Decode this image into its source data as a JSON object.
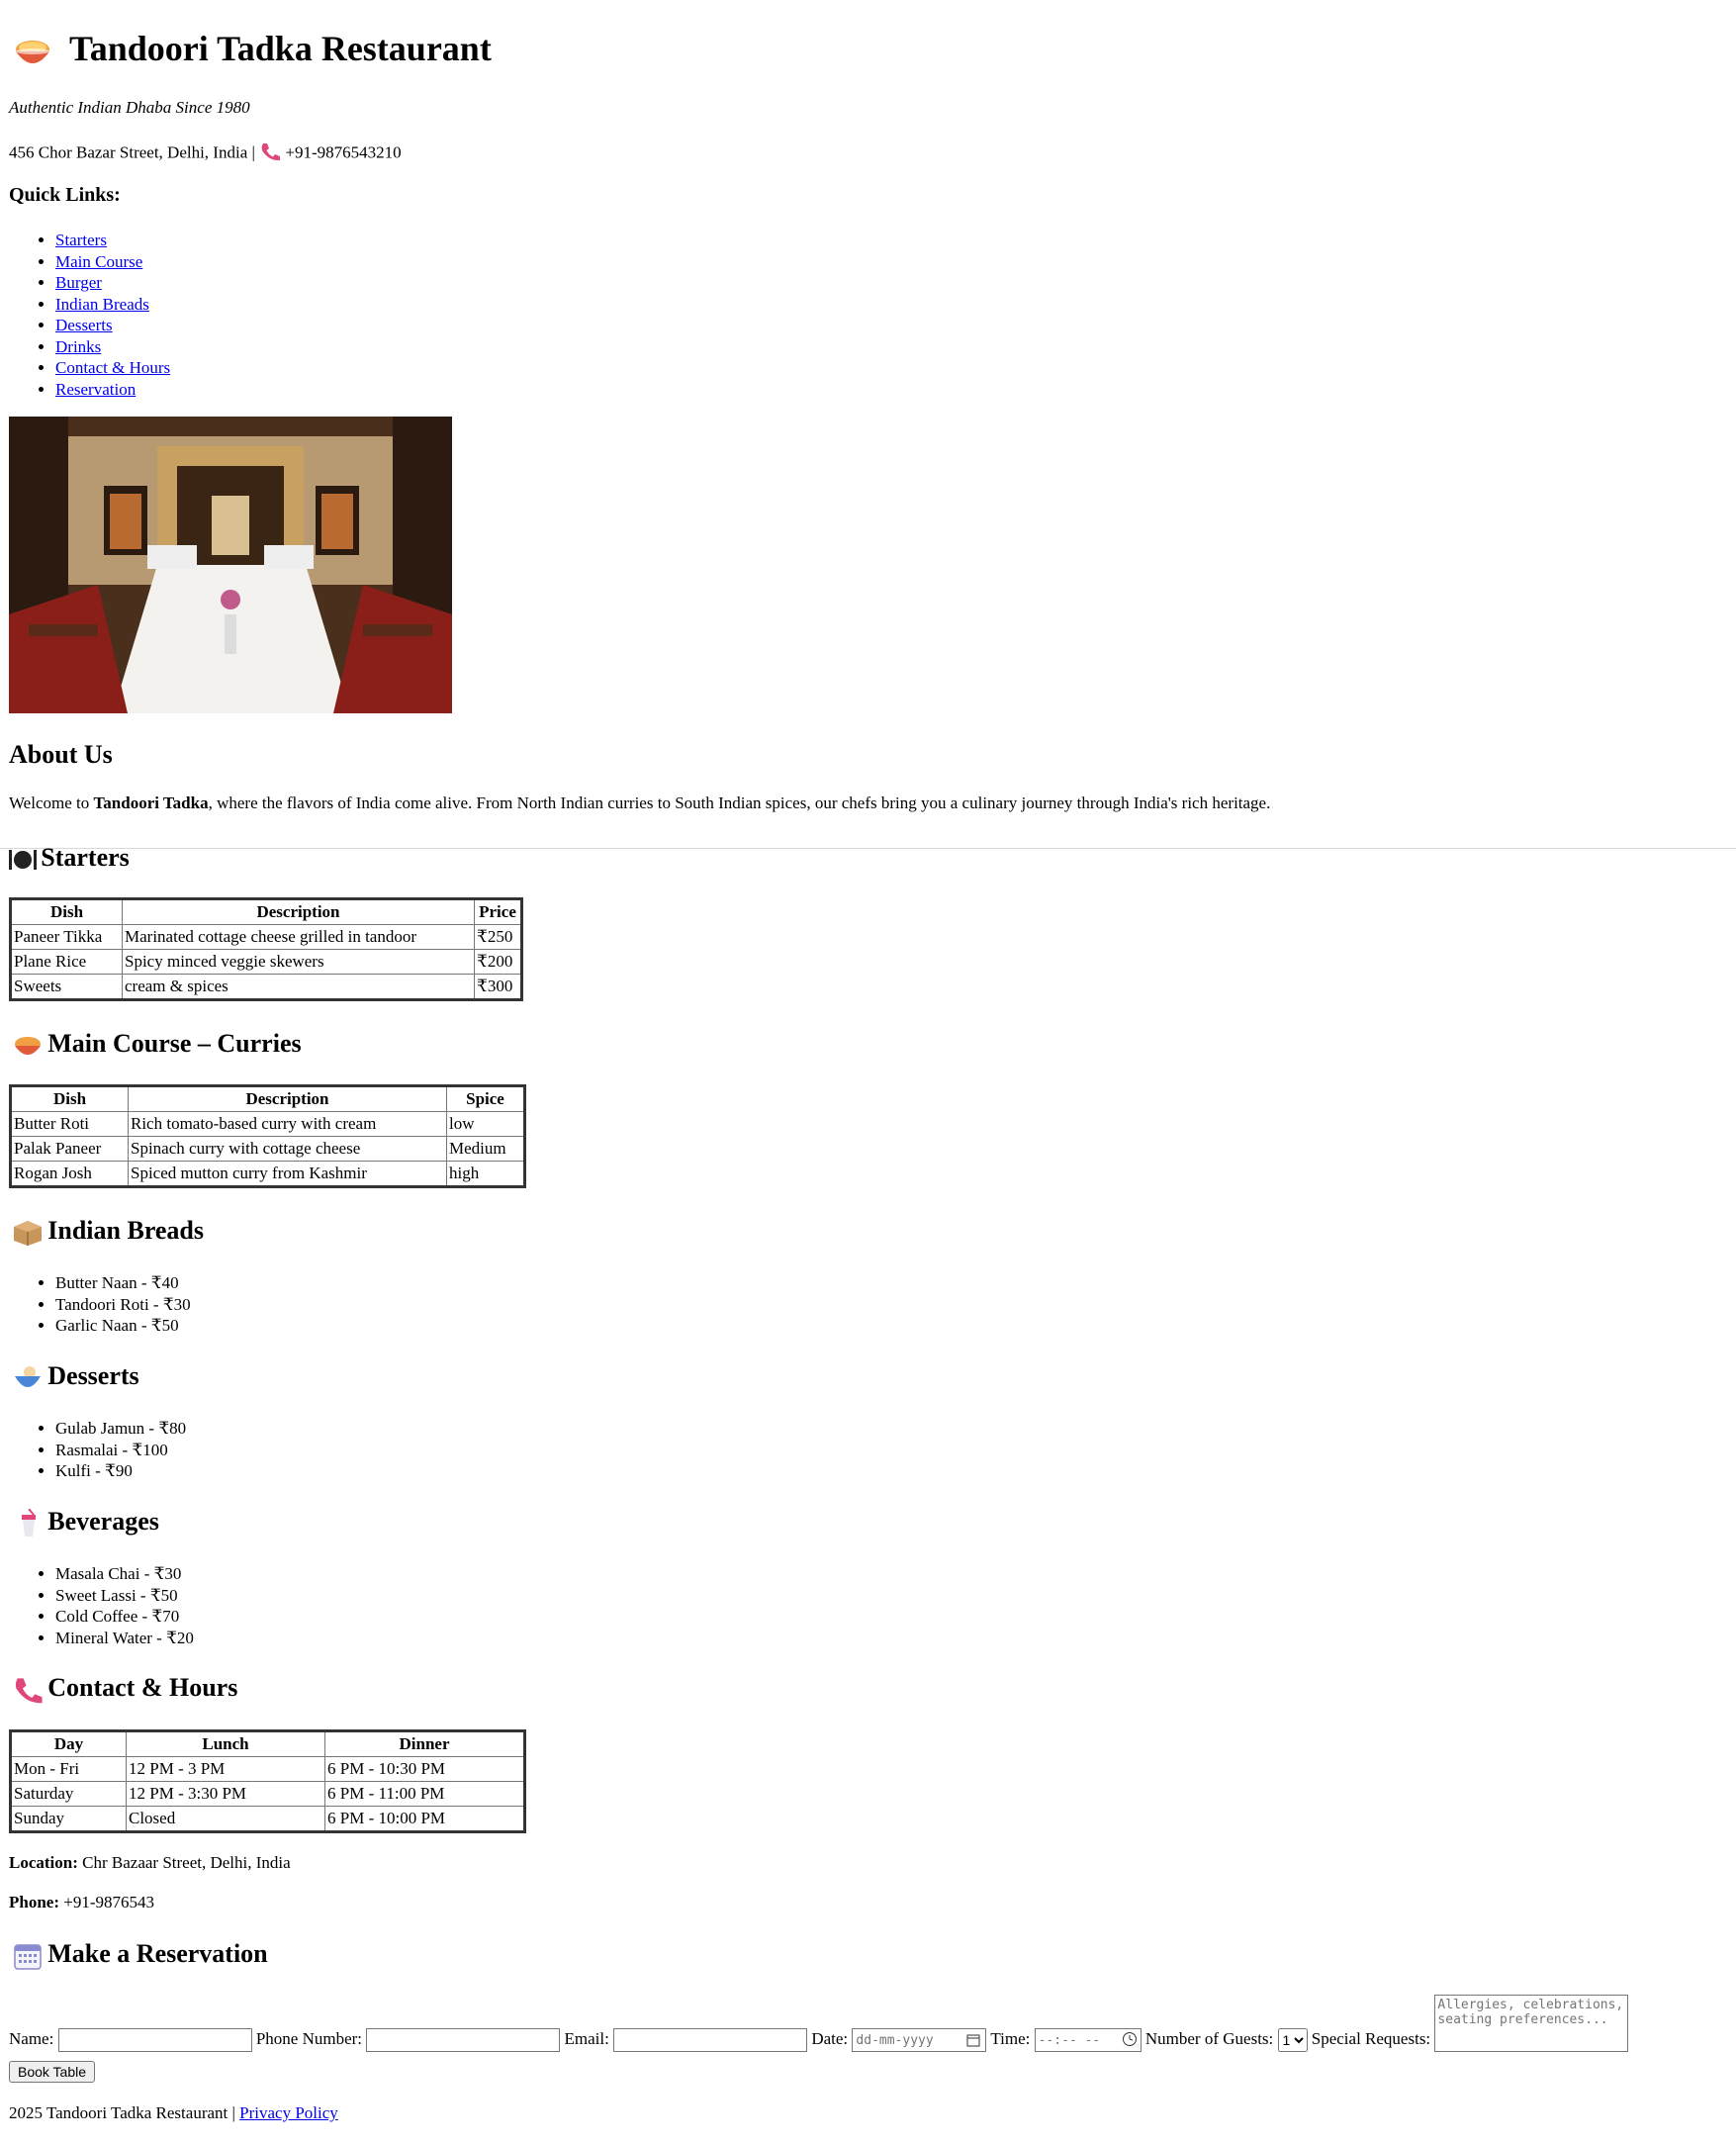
{
  "header": {
    "title": "Tandoori Tadka Restaurant",
    "tagline": "Authentic Indian Dhaba Since 1980",
    "address": "456 Chor Bazar Street, Delhi, India |",
    "phone": "+91-9876543210"
  },
  "quick_links": {
    "heading": "Quick Links:",
    "items": [
      "Starters",
      "Main Course",
      "Burger",
      "Indian Breads",
      "Desserts",
      "Drinks",
      "Contact & Hours",
      "Reservation"
    ]
  },
  "about": {
    "heading": "About Us",
    "prefix": "Welcome to",
    "name": "Tandoori Tadka",
    "suffix": ", where the flavors of India come alive. From North Indian curries to South Indian spices, our chefs bring you a culinary journey through India's rich heritage."
  },
  "starters": {
    "heading": "Starters",
    "columns": [
      "Dish",
      "Description",
      "Price"
    ],
    "rows": [
      [
        "Paneer Tikka",
        "Marinated cottage cheese grilled in tandoor",
        "₹250"
      ],
      [
        "Plane Rice",
        "Spicy minced veggie skewers",
        "₹200"
      ],
      [
        "Sweets",
        "cream & spices",
        "₹300"
      ]
    ]
  },
  "main_course": {
    "heading": "Main Course – Curries",
    "columns": [
      "Dish",
      "Description",
      "Spice"
    ],
    "rows": [
      [
        "Butter Roti",
        "Rich tomato-based curry with cream",
        "low"
      ],
      [
        "Palak Paneer",
        "Spinach curry with cottage cheese",
        "Medium"
      ],
      [
        "Rogan Josh",
        "Spiced mutton curry from Kashmir",
        "high"
      ]
    ]
  },
  "breads": {
    "heading": "Indian Breads",
    "items": [
      "Butter Naan - ₹40",
      "Tandoori Roti - ₹30",
      "Garlic Naan - ₹50"
    ]
  },
  "desserts": {
    "heading": "Desserts",
    "items": [
      "Gulab Jamun - ₹80",
      "Rasmalai - ₹100",
      "Kulfi - ₹90"
    ]
  },
  "beverages": {
    "heading": "Beverages",
    "items": [
      "Masala Chai - ₹30",
      "Sweet Lassi - ₹50",
      "Cold Coffee - ₹70",
      "Mineral Water - ₹20"
    ]
  },
  "contact": {
    "heading": "Contact & Hours",
    "columns": [
      "Day",
      "Lunch",
      "Dinner"
    ],
    "rows": [
      [
        "Mon - Fri",
        "12 PM - 3 PM",
        "6 PM - 10:30 PM"
      ],
      [
        "Saturday",
        "12 PM - 3:30 PM",
        "6 PM - 11:00 PM"
      ],
      [
        "Sunday",
        "Closed",
        "6 PM - 10:00 PM"
      ]
    ],
    "location_label": "Location:",
    "location_value": "Chr Bazaar Street, Delhi, India",
    "phone_label": "Phone:",
    "phone_value": "+91-9876543"
  },
  "reservation": {
    "heading": "Make a Reservation",
    "name_label": "Name:",
    "phone_label": "Phone Number:",
    "email_label": "Email:",
    "date_label": "Date:",
    "date_placeholder": "dd-mm-yyyy",
    "time_label": "Time:",
    "time_placeholder": "--:-- --",
    "guests_label": "Number of Guests:",
    "guests_value": "1",
    "requests_label": "Special Requests:",
    "requests_placeholder": "Allergies, celebrations, seating preferences...",
    "submit_label": "Book Table"
  },
  "footer": {
    "text": "2025 Tandoori Tadka Restaurant |",
    "privacy_link": "Privacy Policy"
  },
  "colors": {
    "link": "#0000ee",
    "phone_icon": "#e0457b"
  }
}
